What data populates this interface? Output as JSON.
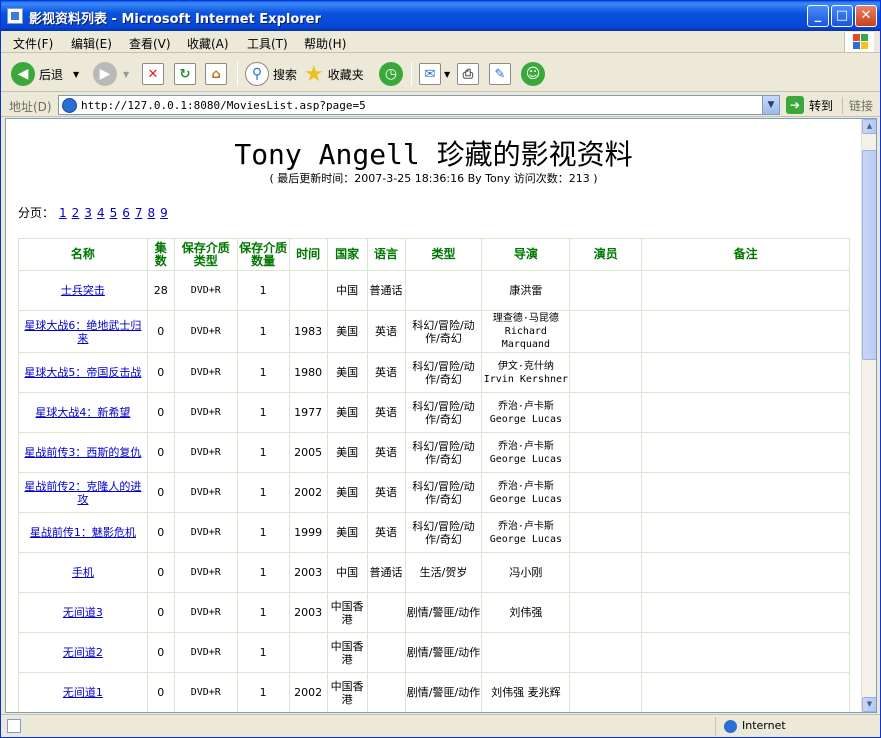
{
  "window": {
    "title": "影视资料列表 - Microsoft Internet Explorer",
    "min_label": "_",
    "max_label": "□",
    "close_label": "✕"
  },
  "menu": [
    {
      "label": "文件(F)"
    },
    {
      "label": "编辑(E)"
    },
    {
      "label": "查看(V)"
    },
    {
      "label": "收藏(A)"
    },
    {
      "label": "工具(T)"
    },
    {
      "label": "帮助(H)"
    }
  ],
  "toolbar": {
    "back_label": "后退",
    "search_label": "搜索",
    "favorites_label": "收藏夹"
  },
  "address": {
    "label": "地址(D)",
    "url": "http://127.0.0.1:8080/MoviesList.asp?page=5",
    "go_label": "转到",
    "links_label": "链接"
  },
  "page": {
    "heading": "Tony Angell 珍藏的影视资料",
    "subheading": "( 最后更新时间：2007-3-25 18:36:16 By Tony   访问次数：213 )",
    "pager_label": "分页：",
    "pages": [
      "1",
      "2",
      "3",
      "4",
      "5",
      "6",
      "7",
      "8",
      "9"
    ]
  },
  "table": {
    "headers": [
      "名称",
      "集数",
      "保存介质类型",
      "保存介质数量",
      "时间",
      "国家",
      "语言",
      "类型",
      "导演",
      "演员",
      "备注"
    ],
    "rows": [
      {
        "name": "士兵突击",
        "episodes": "28",
        "media": "DVD+R",
        "count": "1",
        "year": "",
        "country": "中国",
        "language": "普通话",
        "genre": "",
        "director": "康洪雷",
        "actors": "",
        "notes": ""
      },
      {
        "name": "星球大战6：绝地武士归来",
        "episodes": "0",
        "media": "DVD+R",
        "count": "1",
        "year": "1983",
        "country": "美国",
        "language": "英语",
        "genre": "科幻/冒险/动作/奇幻",
        "director": "理查德·马昆德 Richard Marquand",
        "actors": "",
        "notes": ""
      },
      {
        "name": "星球大战5：帝国反击战",
        "episodes": "0",
        "media": "DVD+R",
        "count": "1",
        "year": "1980",
        "country": "美国",
        "language": "英语",
        "genre": "科幻/冒险/动作/奇幻",
        "director": "伊文·克什纳 Irvin Kershner",
        "actors": "",
        "notes": ""
      },
      {
        "name": "星球大战4：新希望",
        "episodes": "0",
        "media": "DVD+R",
        "count": "1",
        "year": "1977",
        "country": "美国",
        "language": "英语",
        "genre": "科幻/冒险/动作/奇幻",
        "director": "乔治·卢卡斯 George Lucas",
        "actors": "",
        "notes": ""
      },
      {
        "name": "星战前传3：西斯的复仇",
        "episodes": "0",
        "media": "DVD+R",
        "count": "1",
        "year": "2005",
        "country": "美国",
        "language": "英语",
        "genre": "科幻/冒险/动作/奇幻",
        "director": "乔治·卢卡斯 George Lucas",
        "actors": "",
        "notes": ""
      },
      {
        "name": "星战前传2：克隆人的进攻",
        "episodes": "0",
        "media": "DVD+R",
        "count": "1",
        "year": "2002",
        "country": "美国",
        "language": "英语",
        "genre": "科幻/冒险/动作/奇幻",
        "director": "乔治·卢卡斯 George Lucas",
        "actors": "",
        "notes": ""
      },
      {
        "name": "星战前传1：魅影危机",
        "episodes": "0",
        "media": "DVD+R",
        "count": "1",
        "year": "1999",
        "country": "美国",
        "language": "英语",
        "genre": "科幻/冒险/动作/奇幻",
        "director": "乔治·卢卡斯 George Lucas",
        "actors": "",
        "notes": ""
      },
      {
        "name": "手机",
        "episodes": "0",
        "media": "DVD+R",
        "count": "1",
        "year": "2003",
        "country": "中国",
        "language": "普通话",
        "genre": "生活/贺岁",
        "director": "冯小刚",
        "actors": "",
        "notes": ""
      },
      {
        "name": "无间道3",
        "episodes": "0",
        "media": "DVD+R",
        "count": "1",
        "year": "2003",
        "country": "中国香港",
        "language": "",
        "genre": "剧情/警匪/动作",
        "director": "刘伟强",
        "actors": "",
        "notes": ""
      },
      {
        "name": "无间道2",
        "episodes": "0",
        "media": "DVD+R",
        "count": "1",
        "year": "",
        "country": "中国香港",
        "language": "",
        "genre": "剧情/警匪/动作",
        "director": "",
        "actors": "",
        "notes": ""
      },
      {
        "name": "无间道1",
        "episodes": "0",
        "media": "DVD+R",
        "count": "1",
        "year": "2002",
        "country": "中国香港",
        "language": "",
        "genre": "剧情/警匪/动作",
        "director": "刘伟强 麦兆辉",
        "actors": "",
        "notes": ""
      }
    ]
  },
  "status": {
    "zone": "Internet"
  },
  "colors": {
    "header_text": "#007700",
    "link": "#0000cc",
    "titlebar": "#0a53df"
  }
}
